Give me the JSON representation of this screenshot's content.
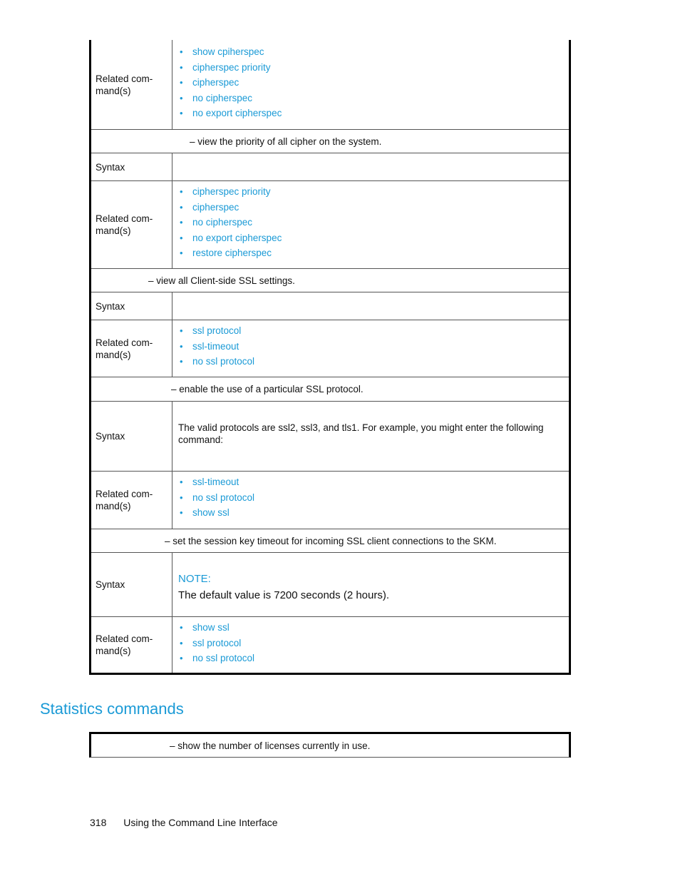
{
  "tables": [
    {
      "rows": [
        {
          "type": "related",
          "label": "Related com-\nmand(s)",
          "items": [
            "show cpiherspec",
            "cipherspec priority",
            "cipherspec",
            "no cipherspec",
            "no export cipherspec"
          ]
        },
        {
          "type": "desc",
          "text": "– view the priority of all cipher on the system."
        },
        {
          "type": "syntax",
          "label": "Syntax",
          "text": ""
        },
        {
          "type": "related",
          "label": "Related com-\nmand(s)",
          "items": [
            "cipherspec priority",
            "cipherspec",
            "no cipherspec",
            "no export cipherspec",
            "restore cipherspec"
          ]
        },
        {
          "type": "desc",
          "text": "– view all Client-side SSL settings."
        },
        {
          "type": "syntax",
          "label": "Syntax",
          "text": ""
        },
        {
          "type": "related",
          "label": "Related com-\nmand(s)",
          "items": [
            "ssl protocol",
            "ssl-timeout",
            "no ssl protocol"
          ]
        },
        {
          "type": "desc",
          "text": "– enable the use of a particular SSL protocol."
        },
        {
          "type": "syntax",
          "label": "Syntax",
          "text": "The valid protocols are ssl2, ssl3, and tls1. For example, you might enter the following command:"
        },
        {
          "type": "related",
          "label": "Related com-\nmand(s)",
          "items": [
            "ssl-timeout",
            "no ssl protocol",
            "show ssl"
          ]
        },
        {
          "type": "desc",
          "text": "– set the session key timeout for incoming SSL client connections to the SKM."
        },
        {
          "type": "note",
          "label": "Syntax",
          "note_title": "NOTE:",
          "note_body": "The default value is 7200 seconds (2 hours)."
        },
        {
          "type": "related",
          "label": "Related com-\nmand(s)",
          "items": [
            "show ssl",
            "ssl protocol",
            "no ssl protocol"
          ]
        }
      ]
    }
  ],
  "section_heading": "Statistics commands",
  "stats_table": {
    "desc": "– show the number of licenses currently in use."
  },
  "footer": {
    "page_number": "318",
    "title": "Using the Command Line Interface"
  }
}
